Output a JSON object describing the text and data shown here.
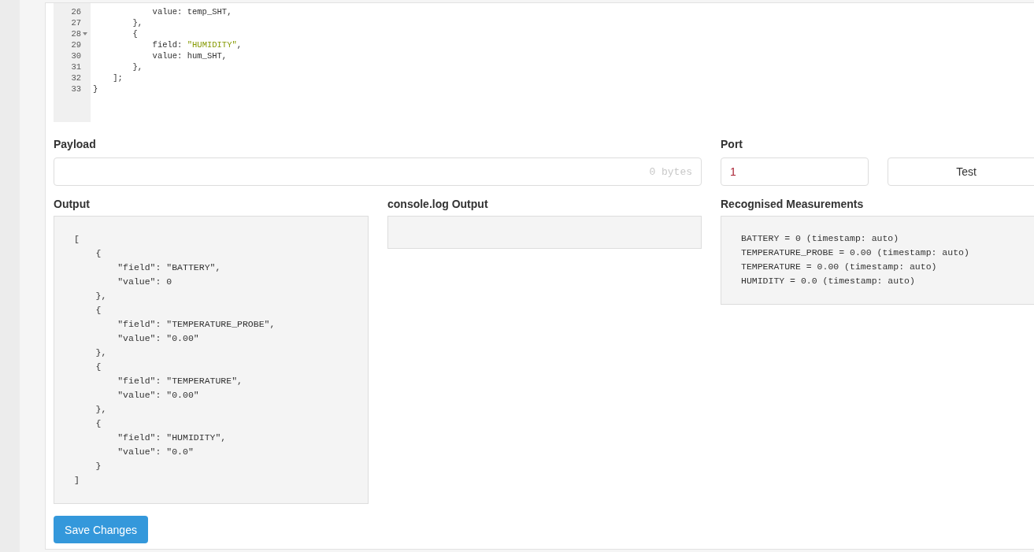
{
  "editor": {
    "lines": [
      {
        "number": "26",
        "fold": false,
        "segments": [
          {
            "kind": "plain",
            "text": "            value: temp_SHT,"
          }
        ]
      },
      {
        "number": "27",
        "fold": false,
        "segments": [
          {
            "kind": "plain",
            "text": "        },"
          }
        ]
      },
      {
        "number": "28",
        "fold": true,
        "segments": [
          {
            "kind": "plain",
            "text": "        {"
          }
        ]
      },
      {
        "number": "29",
        "fold": false,
        "segments": [
          {
            "kind": "plain",
            "text": "            field: "
          },
          {
            "kind": "string",
            "text": "\"HUMIDITY\""
          },
          {
            "kind": "plain",
            "text": ","
          }
        ]
      },
      {
        "number": "30",
        "fold": false,
        "segments": [
          {
            "kind": "plain",
            "text": "            value: hum_SHT,"
          }
        ]
      },
      {
        "number": "31",
        "fold": false,
        "segments": [
          {
            "kind": "plain",
            "text": "        },"
          }
        ]
      },
      {
        "number": "32",
        "fold": false,
        "segments": [
          {
            "kind": "plain",
            "text": "    ];"
          }
        ]
      },
      {
        "number": "33",
        "fold": false,
        "segments": [
          {
            "kind": "plain",
            "text": "}"
          }
        ]
      }
    ]
  },
  "payload": {
    "label": "Payload",
    "placeholder": "0 bytes"
  },
  "port": {
    "label": "Port",
    "value": "1"
  },
  "test_button": "Test",
  "output": {
    "label": "Output",
    "lines": [
      "[",
      "    {",
      "        \"field\": \"BATTERY\",",
      "        \"value\": 0",
      "    },",
      "    {",
      "        \"field\": \"TEMPERATURE_PROBE\",",
      "        \"value\": \"0.00\"",
      "    },",
      "    {",
      "        \"field\": \"TEMPERATURE\",",
      "        \"value\": \"0.00\"",
      "    },",
      "    {",
      "        \"field\": \"HUMIDITY\",",
      "        \"value\": \"0.0\"",
      "    }",
      "]"
    ]
  },
  "console_output": {
    "label": "console.log Output"
  },
  "measurements": {
    "label": "Recognised Measurements",
    "lines": [
      "BATTERY = 0 (timestamp: auto)",
      "TEMPERATURE_PROBE = 0.00 (timestamp: auto)",
      "TEMPERATURE = 0.00 (timestamp: auto)",
      "HUMIDITY = 0.0 (timestamp: auto)"
    ]
  },
  "save_button": "Save Changes"
}
